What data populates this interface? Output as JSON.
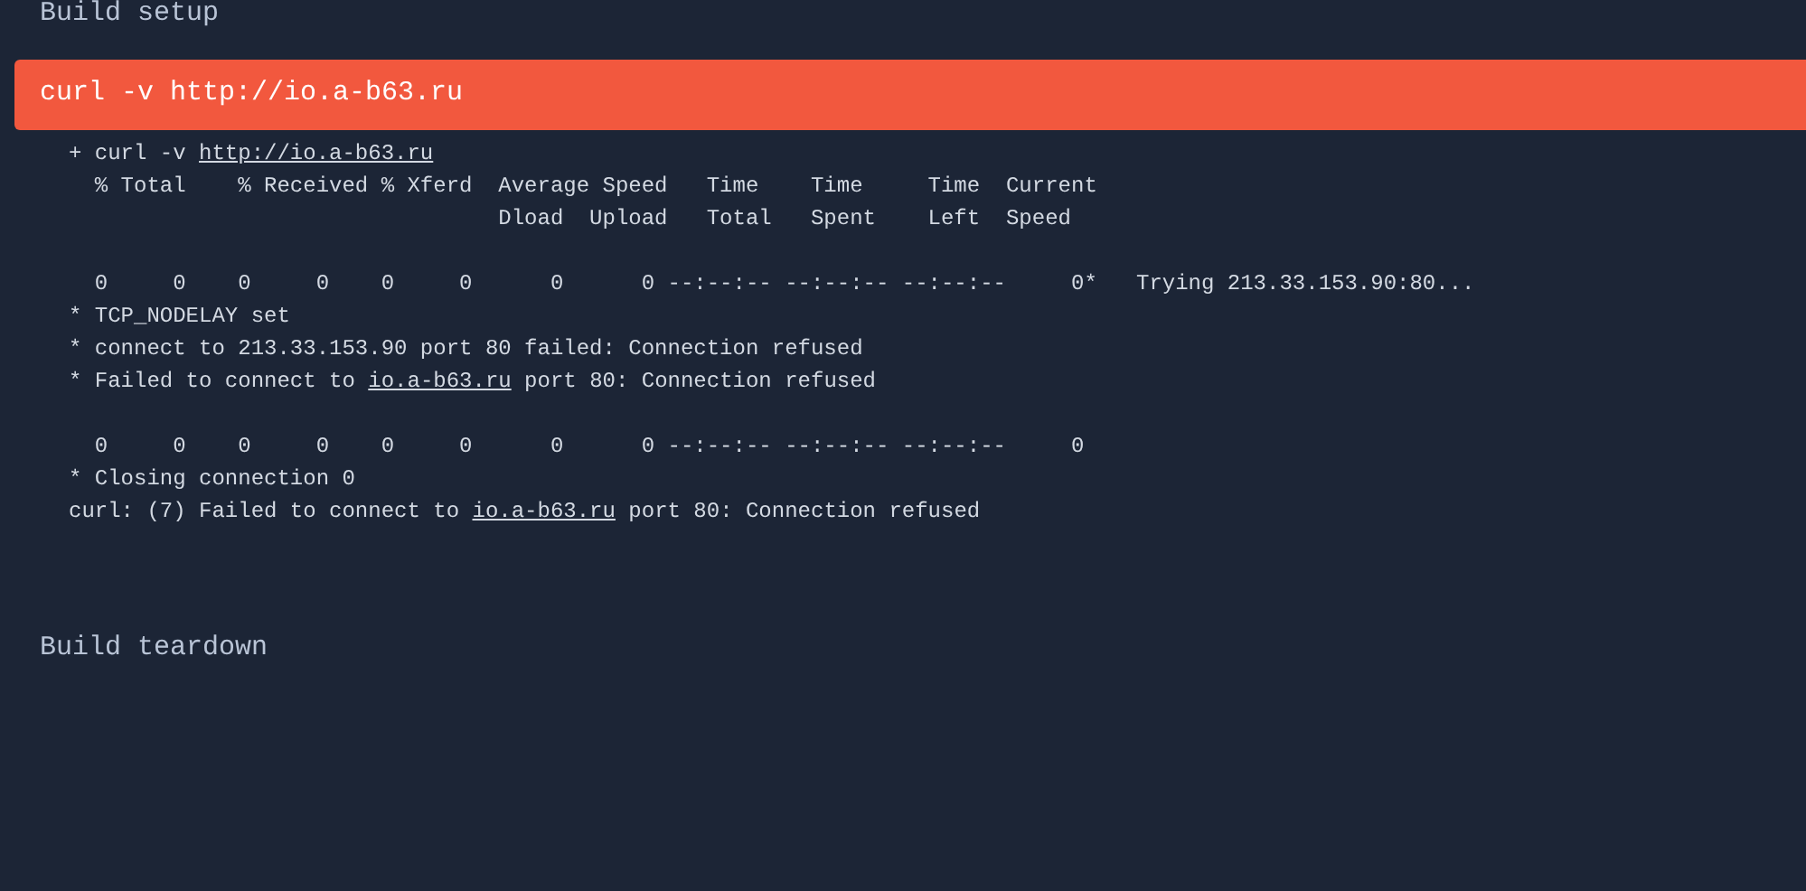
{
  "sections": [
    {
      "kind": "header",
      "title": "Build setup"
    },
    {
      "kind": "step",
      "command": "curl -v http://io.a-b63.ru",
      "selected": true,
      "log": [
        {
          "kind": "text",
          "segments": [
            {
              "text": "+ curl -v ",
              "link": false
            },
            {
              "text": "http://io.a-b63.ru",
              "link": true
            }
          ]
        },
        {
          "kind": "text",
          "segments": [
            {
              "text": "  % Total    % Received % Xferd  Average Speed   Time    Time     Time  Current",
              "link": false
            }
          ]
        },
        {
          "kind": "text",
          "segments": [
            {
              "text": "                                 Dload  Upload   Total   Spent    Left  Speed",
              "link": false
            }
          ]
        },
        {
          "kind": "blank"
        },
        {
          "kind": "text",
          "segments": [
            {
              "text": "  0     0    0     0    0     0      0      0 --:--:-- --:--:-- --:--:--     0*   Trying 213.33.153.90:80...",
              "link": false
            }
          ]
        },
        {
          "kind": "text",
          "segments": [
            {
              "text": "* TCP_NODELAY set",
              "link": false
            }
          ]
        },
        {
          "kind": "text",
          "segments": [
            {
              "text": "* connect to 213.33.153.90 port 80 failed: Connection refused",
              "link": false
            }
          ]
        },
        {
          "kind": "text",
          "segments": [
            {
              "text": "* Failed to connect to ",
              "link": false
            },
            {
              "text": "io.a-b63.ru",
              "link": true
            },
            {
              "text": " port 80: Connection refused",
              "link": false
            }
          ]
        },
        {
          "kind": "blank"
        },
        {
          "kind": "text",
          "segments": [
            {
              "text": "  0     0    0     0    0     0      0      0 --:--:-- --:--:-- --:--:--     0",
              "link": false
            }
          ]
        },
        {
          "kind": "text",
          "segments": [
            {
              "text": "* Closing connection 0",
              "link": false
            }
          ]
        },
        {
          "kind": "text",
          "segments": [
            {
              "text": "curl: (7) Failed to connect to ",
              "link": false
            },
            {
              "text": "io.a-b63.ru",
              "link": true
            },
            {
              "text": " port 80: Connection refused",
              "link": false
            }
          ]
        }
      ]
    },
    {
      "kind": "header",
      "title": "Build teardown"
    }
  ]
}
